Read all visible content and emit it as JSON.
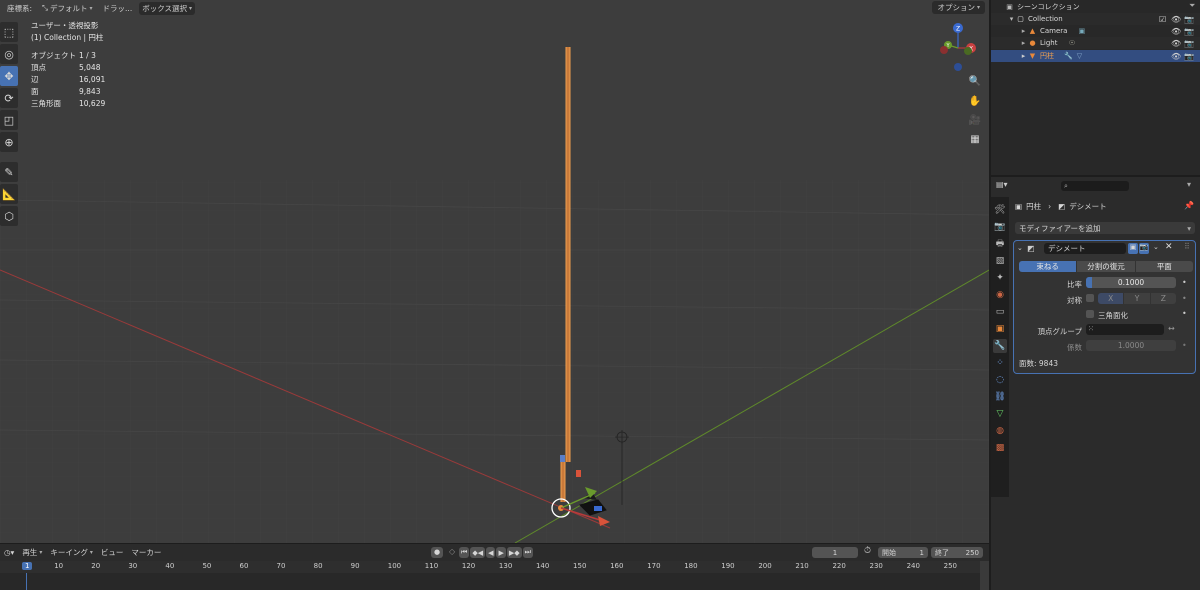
{
  "viewport": {
    "header": {
      "orientation_label": "座標系:",
      "orientation_value": "デフォルト",
      "drag_label": "ドラッ...",
      "select_mode": "ボックス選択",
      "options_label": "オプション"
    },
    "overlay": {
      "view_name": "ユーザー・透視投影",
      "collection_line": "(1) Collection | 円柱",
      "stats": [
        {
          "label": "オブジェクト",
          "value": "1 / 3"
        },
        {
          "label": "頂点",
          "value": "5,048"
        },
        {
          "label": "辺",
          "value": "16,091"
        },
        {
          "label": "面",
          "value": "9,843"
        },
        {
          "label": "三角形面",
          "value": "10,629"
        }
      ]
    },
    "gizmo": {
      "x": "X",
      "y": "Y",
      "z": "Z"
    }
  },
  "outliner": {
    "title": "シーンコレクション",
    "rows": [
      {
        "name": "Collection"
      },
      {
        "name": "Camera"
      },
      {
        "name": "Light"
      },
      {
        "name": "円柱"
      }
    ]
  },
  "properties": {
    "breadcrumb": {
      "object": "円柱",
      "modifier": "デシメート"
    },
    "add_modifier": "モディファイアーを追加",
    "modifier": {
      "name": "デシメート",
      "modes": [
        "束ねる",
        "分割の復元",
        "平面"
      ],
      "ratio_label": "比率",
      "ratio_value": "0.1000",
      "symmetry_label": "対称",
      "axes": [
        "X",
        "Y",
        "Z"
      ],
      "triangulate_label": "三角面化",
      "vertex_group_label": "頂点グループ",
      "factor_label": "係数",
      "factor_value": "1.0000",
      "face_count": "面数: 9843"
    }
  },
  "timeline": {
    "menus": [
      "再生",
      "キーイング",
      "ビュー",
      "マーカー"
    ],
    "current_frame": "1",
    "start_label": "開始",
    "start_value": "1",
    "end_label": "終了",
    "end_value": "250",
    "ruler": [
      "1",
      "10",
      "20",
      "30",
      "40",
      "50",
      "60",
      "70",
      "80",
      "90",
      "100",
      "110",
      "120",
      "130",
      "140",
      "150",
      "160",
      "170",
      "180",
      "190",
      "200",
      "210",
      "220",
      "230",
      "240",
      "250"
    ]
  },
  "colors": {
    "accent": "#4772b3",
    "selected_object": "#e8883a",
    "x_axis": "#b83a3a",
    "y_axis": "#6a9a2c"
  }
}
